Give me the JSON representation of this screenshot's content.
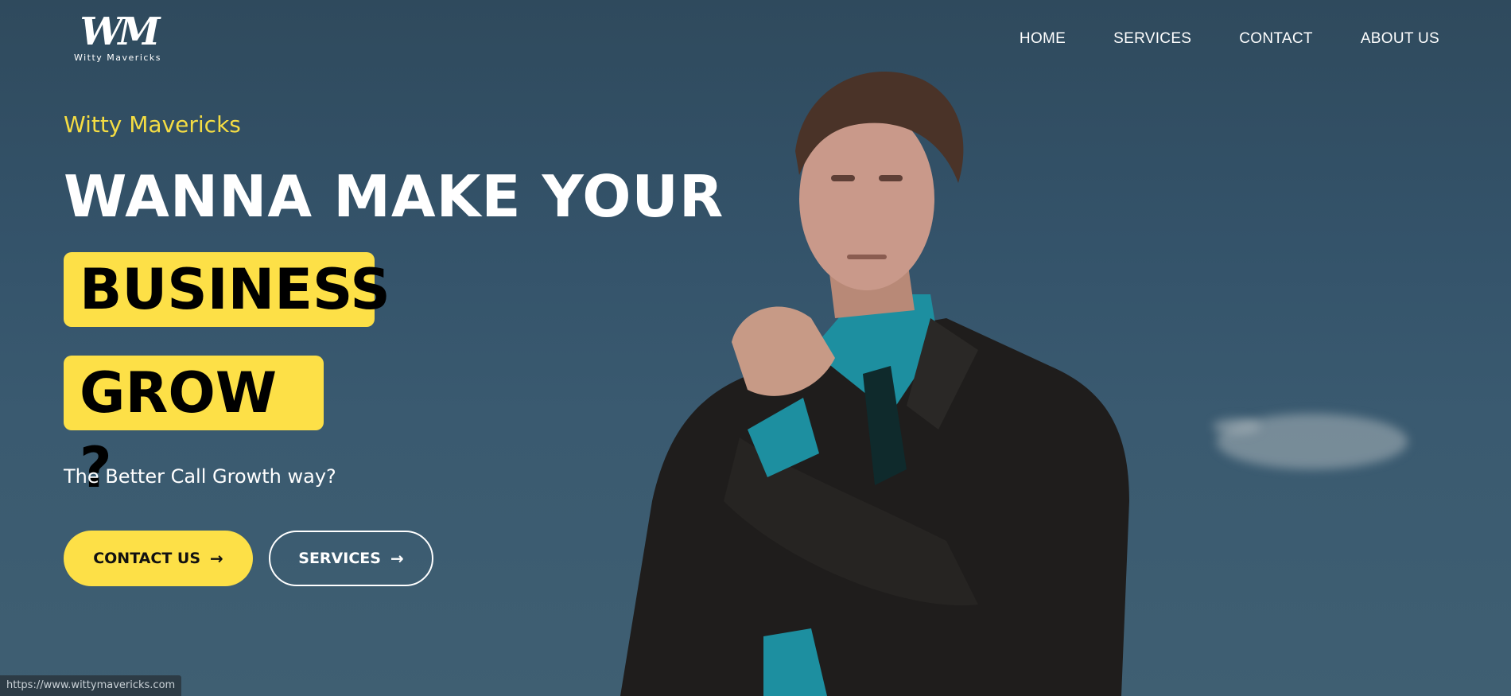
{
  "brand": {
    "logo_mark": "WM",
    "logo_text": "Witty Mavericks"
  },
  "nav": {
    "items": [
      {
        "label": "HOME"
      },
      {
        "label": "SERVICES"
      },
      {
        "label": "CONTACT"
      },
      {
        "label": "ABOUT US"
      }
    ]
  },
  "hero": {
    "eyebrow": "Witty Mavericks",
    "headline": "WANNA MAKE YOUR",
    "highlight_1": "BUSINESS",
    "highlight_2": "GROW ?",
    "subtext": "The Better Call Growth way?",
    "cta_primary": "CONTACT US",
    "cta_secondary": "SERVICES",
    "arrow_icon": "→"
  },
  "status_bar": {
    "url": "https://www.wittymavericks.com"
  },
  "colors": {
    "accent": "#fde047",
    "background": "#34536a",
    "text": "#ffffff"
  }
}
